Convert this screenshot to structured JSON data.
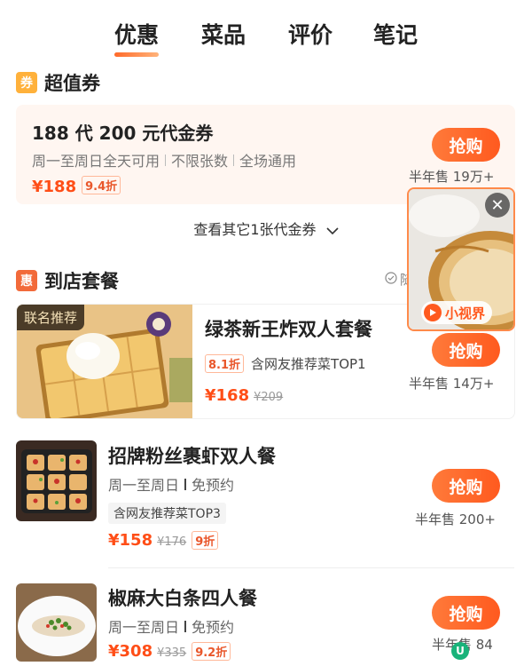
{
  "tabs": [
    {
      "label": "优惠",
      "active": true
    },
    {
      "label": "菜品",
      "active": false
    },
    {
      "label": "评价",
      "active": false
    },
    {
      "label": "笔记",
      "active": false
    }
  ],
  "voucher_section": {
    "badge": "券",
    "title": "超值券",
    "voucher": {
      "title": "188 代 200 元代金券",
      "tags": [
        "周一至周日全天可用",
        "不限张数",
        "全场通用"
      ],
      "price": "¥188",
      "discount": "9.4折",
      "button": "抢购",
      "sold": "半年售 19万+"
    },
    "more_link": "查看其它1张代金券"
  },
  "package_section": {
    "badge": "惠",
    "title": "到店套餐",
    "side_hint_text": "随",
    "items": [
      {
        "corner_label": "联名推荐",
        "title": "绿茶新王炸双人套餐",
        "discount": "8.1折",
        "rec_tag": "含网友推荐菜TOP1",
        "price": "¥168",
        "orig_price": "¥209",
        "button": "抢购",
        "sold": "半年售 14万+"
      },
      {
        "title": "招牌粉丝裹虾双人餐",
        "sub": [
          "周一至周日",
          "免预约"
        ],
        "rec_tag": "含网友推荐菜TOP3",
        "price": "¥158",
        "orig_price": "¥176",
        "discount": "9折",
        "button": "抢购",
        "sold": "半年售 200+"
      },
      {
        "title": "椒麻大白条四人餐",
        "sub": [
          "周一至周日",
          "免预约"
        ],
        "price": "¥308",
        "orig_price": "¥335",
        "discount": "9.2折",
        "button": "抢购",
        "sold": "半年售 84"
      }
    ]
  },
  "video_popup": {
    "label": "小视界"
  },
  "badge_u": "U",
  "colors": {
    "accent": "#ff5a1f",
    "voucher_bg": "#fff6f1",
    "badge_orange": "#ffb13b",
    "badge_red": "#f26a3a"
  }
}
